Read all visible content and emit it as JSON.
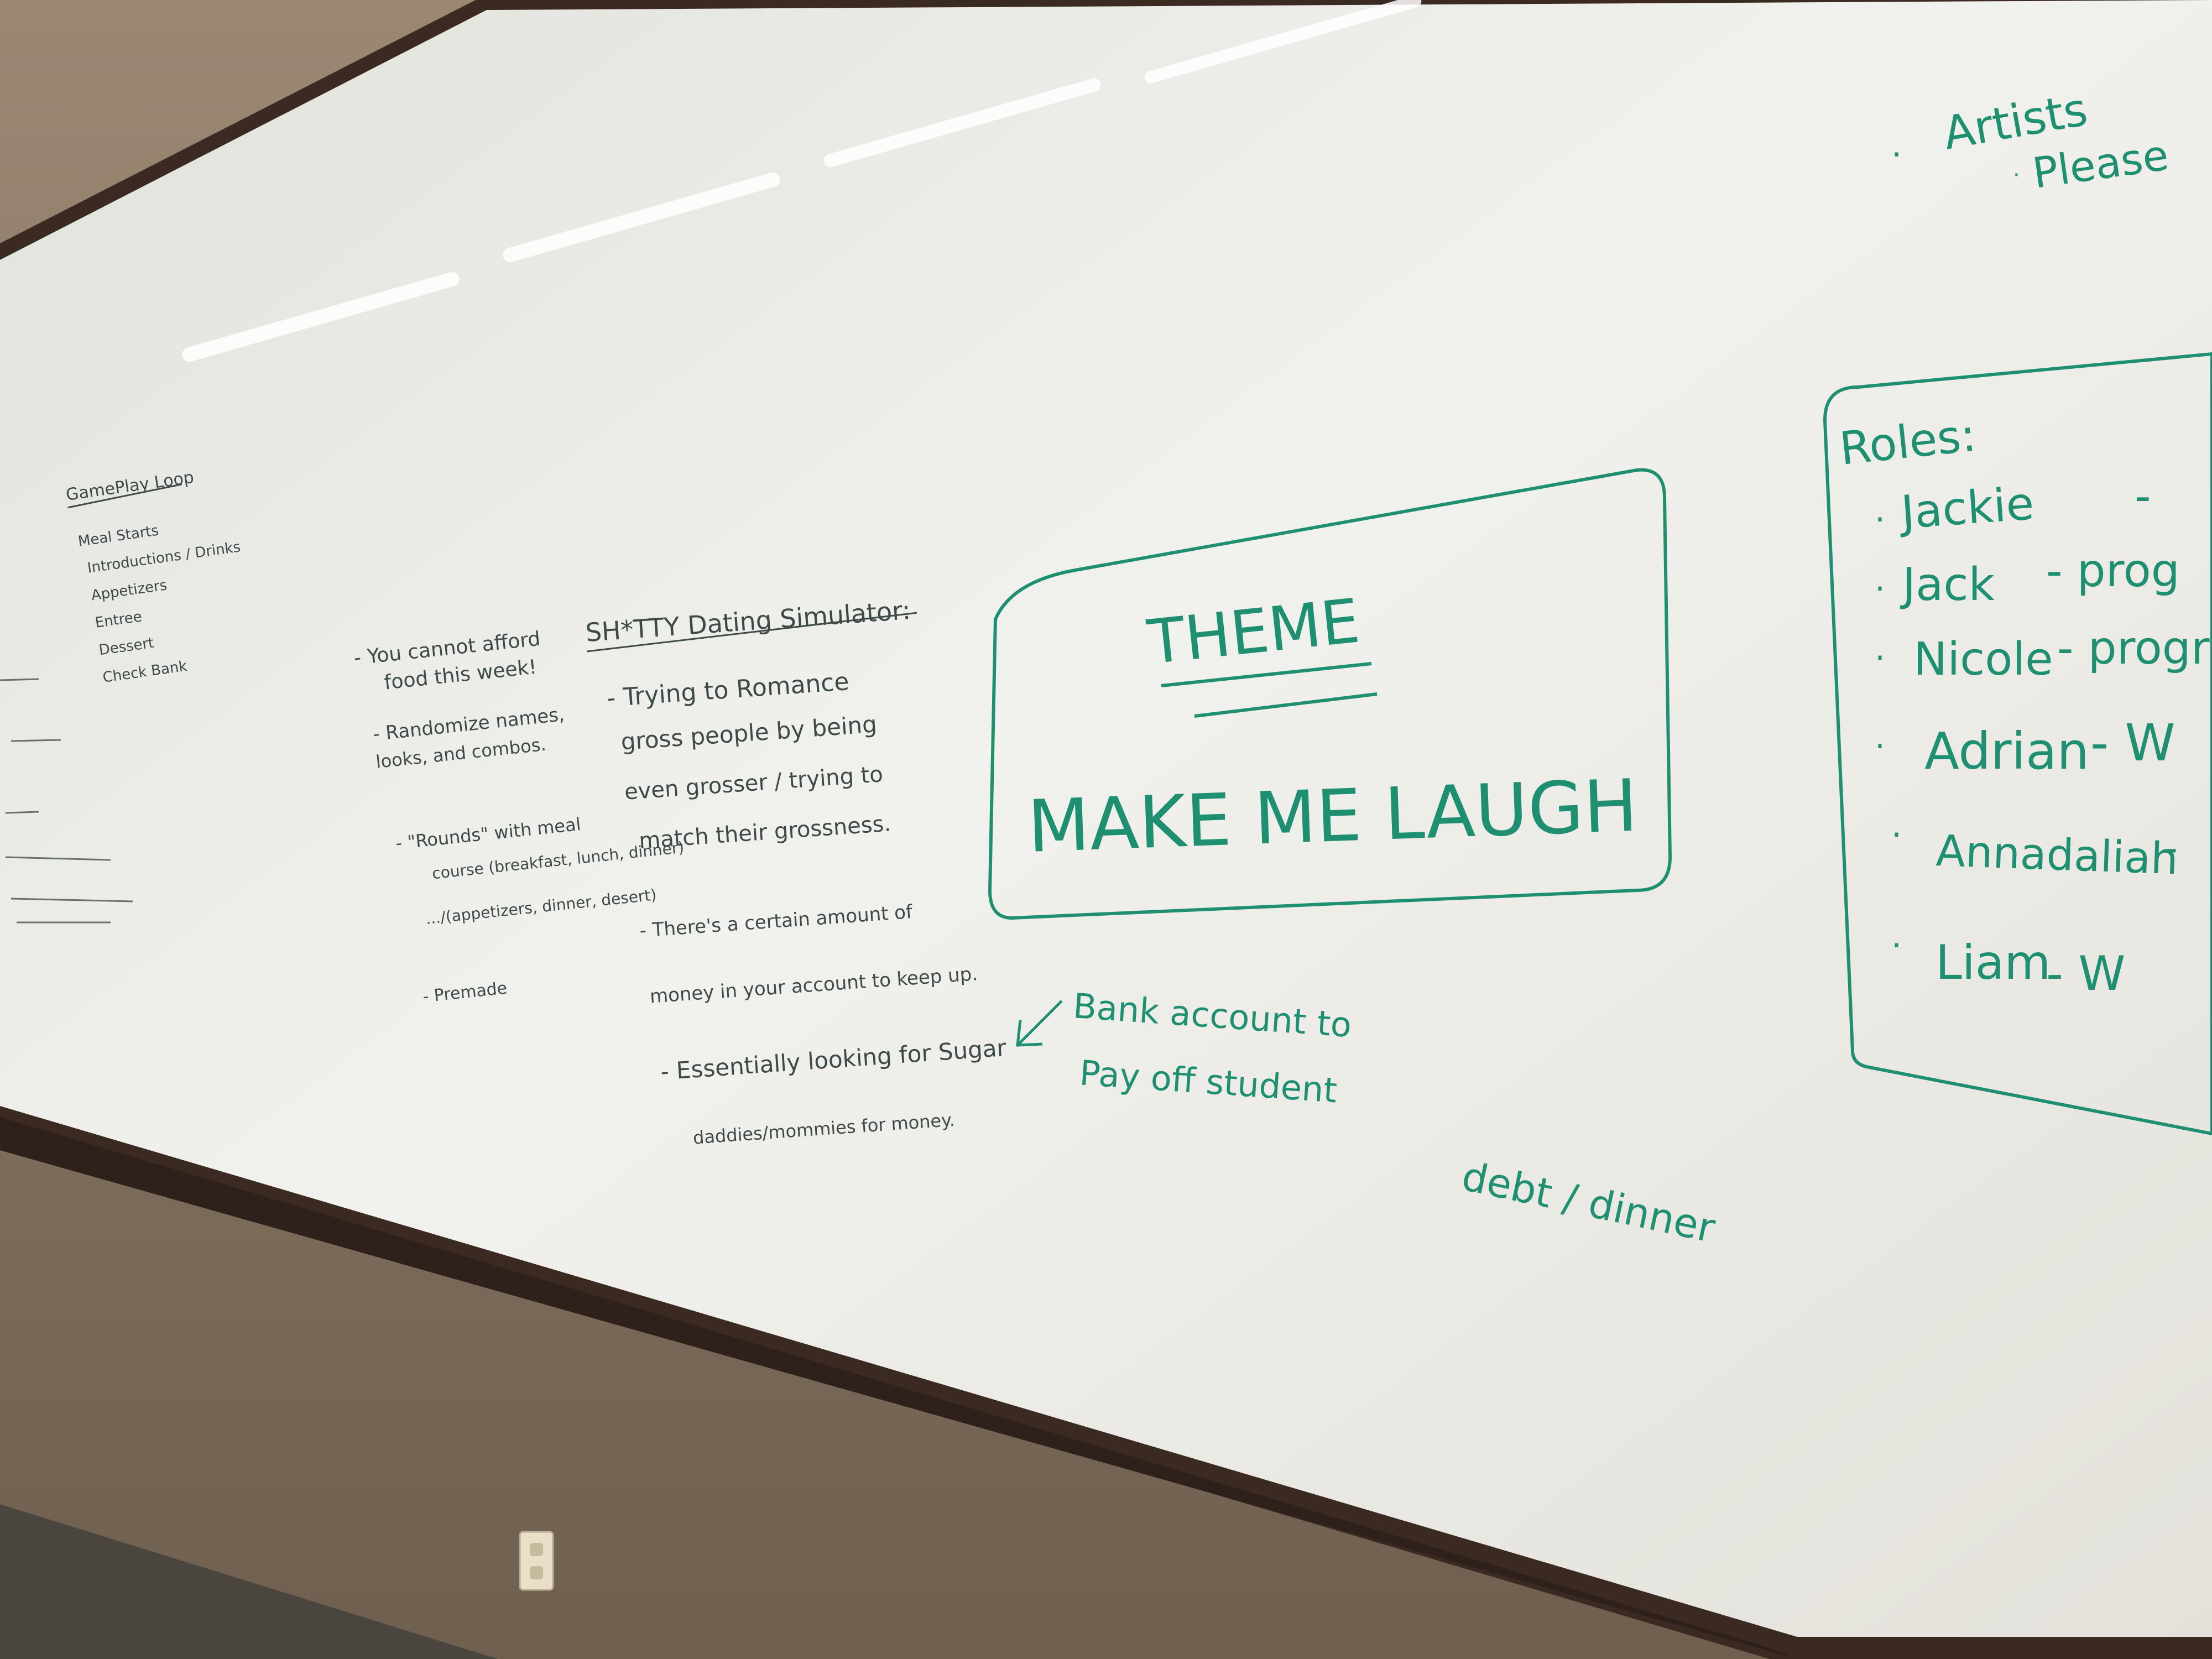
{
  "colors": {
    "wall": "#8a7a68",
    "board": "#ecebe6",
    "frame": "#3a2a22",
    "green_marker": "#1f8f72",
    "dark_marker": "#3d4a45"
  },
  "gameplay": {
    "heading": "GamePlay Loop",
    "items": [
      "Meal Starts",
      "Introductions / Drinks",
      "Appetizers",
      "Entree",
      "Dessert",
      "Check Bank"
    ]
  },
  "notes_left": {
    "lines": [
      "- You cannot afford",
      "food this week!",
      "- Randomize names,",
      "looks, and combos.",
      "- \"Rounds\" with meal",
      "course (breakfast, lunch, dinner)",
      ".../(appetizers, dinner, desert)",
      "- Premade"
    ]
  },
  "simulator": {
    "title": "SH*TTY Dating Simulator:",
    "lines": [
      "- Trying to Romance",
      "gross people by being",
      "even grosser / trying to",
      "match their grossness.",
      "- There's a certain amount of",
      "money in your account to keep up.",
      "- Essentially looking for Sugar",
      "daddies/mommies for money."
    ]
  },
  "bank_note": {
    "lines": [
      "Bank account to",
      "Pay off student",
      "debt / dinner"
    ]
  },
  "theme": {
    "label": "THEME",
    "value": "MAKE ME LAUGH"
  },
  "roles": {
    "heading": "Roles:",
    "people": [
      {
        "name": "Jackie",
        "role": "-"
      },
      {
        "name": "Jack",
        "role": "- prog"
      },
      {
        "name": "Nicole",
        "role": "- progr"
      },
      {
        "name": "Adrian",
        "role": "- W"
      },
      {
        "name": "Annadaliah",
        "role": "-"
      },
      {
        "name": "Liam",
        "role": "- W"
      }
    ]
  },
  "top_right": {
    "lines": [
      "Artists",
      "Please"
    ]
  }
}
